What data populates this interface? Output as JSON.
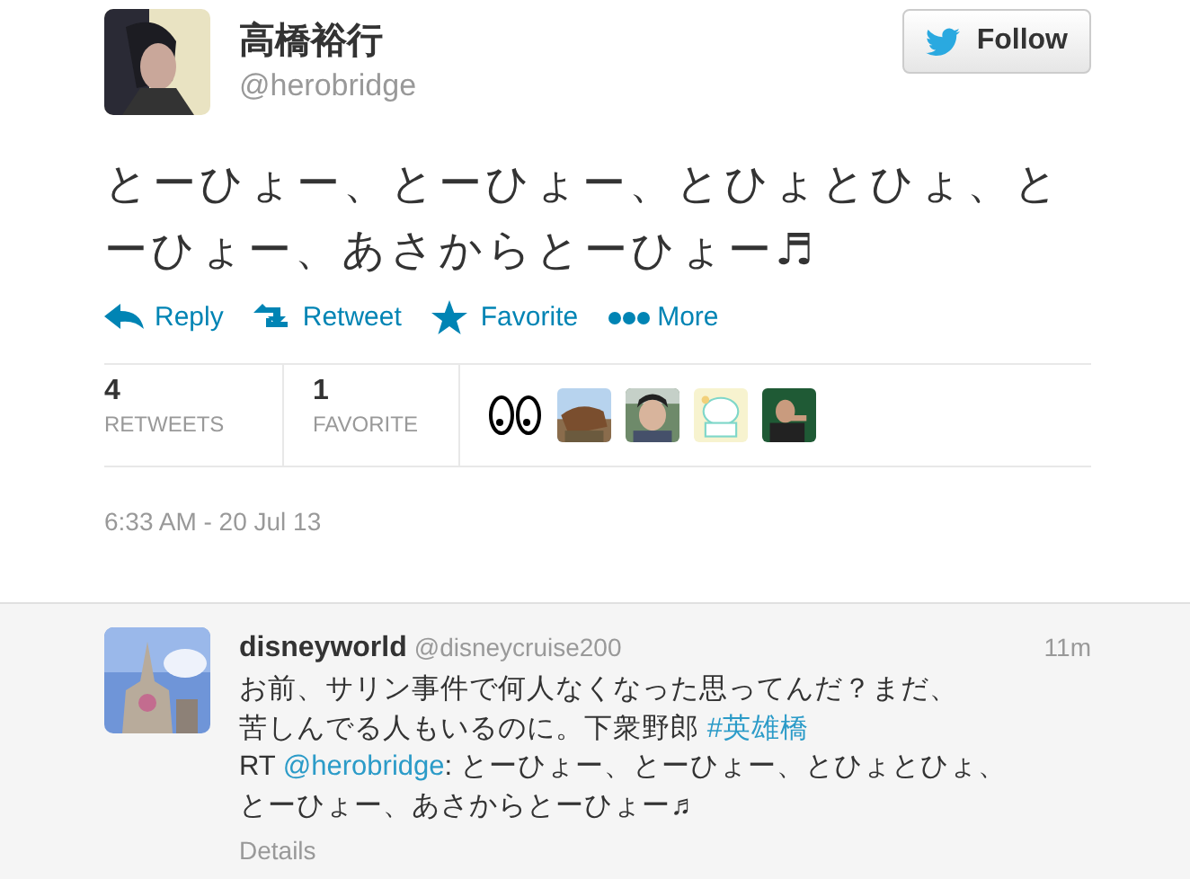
{
  "tweet": {
    "name": "高橋裕行",
    "handle": "@herobridge",
    "follow_button": "Follow",
    "text": "とーひょー、とーひょー、とひょとひょ、とーひょー、あさからとーひょー♬",
    "actions": [
      {
        "kind": "reply",
        "label": "Reply"
      },
      {
        "kind": "retweet",
        "label": "Retweet"
      },
      {
        "kind": "favorite",
        "label": "Favorite"
      },
      {
        "kind": "more",
        "label": "More"
      }
    ],
    "stats": [
      {
        "count": "4",
        "label": "RETWEETS"
      },
      {
        "count": "1",
        "label": "FAVORITE"
      }
    ],
    "favoriters": [
      {
        "kind": "eyes"
      },
      {
        "kind": "picture"
      },
      {
        "kind": "picture"
      },
      {
        "kind": "picture"
      },
      {
        "kind": "picture"
      }
    ],
    "timestamp": "6:33 AM - 20 Jul 13"
  },
  "reply": {
    "name": "disneyworld",
    "handle": "@disneycruise200",
    "time": "11m",
    "lines": [
      [
        {
          "kind": "text",
          "text": "お前、サリン事件で何人なくなった思ってんだ？まだ、"
        }
      ],
      [
        {
          "kind": "text",
          "text": "苦しんでる人もいるのに。下衆野郎 "
        },
        {
          "kind": "link",
          "text": "#英雄橋"
        }
      ],
      [
        {
          "kind": "text",
          "text": "RT "
        },
        {
          "kind": "link",
          "text": "@herobridge"
        },
        {
          "kind": "text",
          "text": ": とーひょー、とーひょー、とひょとひょ、"
        }
      ],
      [
        {
          "kind": "text",
          "text": "とーひょー、あさからとーひょー♬"
        }
      ]
    ],
    "details": "Details"
  }
}
